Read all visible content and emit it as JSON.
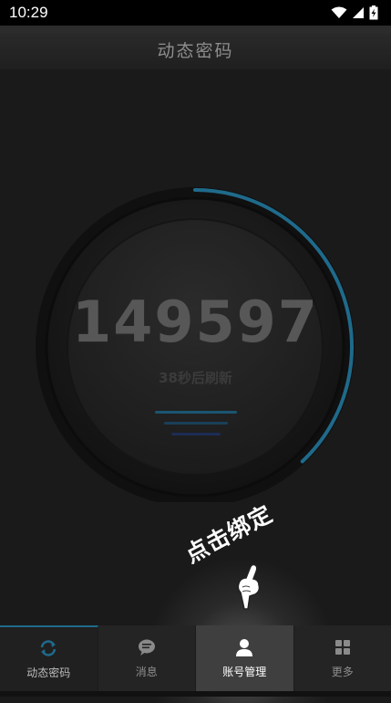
{
  "status_bar": {
    "time": "10:29",
    "icons": [
      "wifi-icon",
      "signal-icon",
      "battery-charging-icon"
    ]
  },
  "header": {
    "title": "动态密码"
  },
  "otp": {
    "code": "149597",
    "refresh_text": "38秒后刷新",
    "remaining_fraction": 0.38
  },
  "hint": {
    "text": "点击绑定",
    "icon": "pointing-hand-icon"
  },
  "tabs": [
    {
      "label": "动态密码",
      "icon": "refresh-icon",
      "state": "selected"
    },
    {
      "label": "消息",
      "icon": "chat-bubble-icon",
      "state": "normal"
    },
    {
      "label": "账号管理",
      "icon": "user-icon",
      "state": "highlighted"
    },
    {
      "label": "更多",
      "icon": "grid-icon",
      "state": "normal"
    }
  ],
  "colors": {
    "accent": "#1f6a8b",
    "background": "#1a1a1b",
    "digits": "#575757"
  }
}
